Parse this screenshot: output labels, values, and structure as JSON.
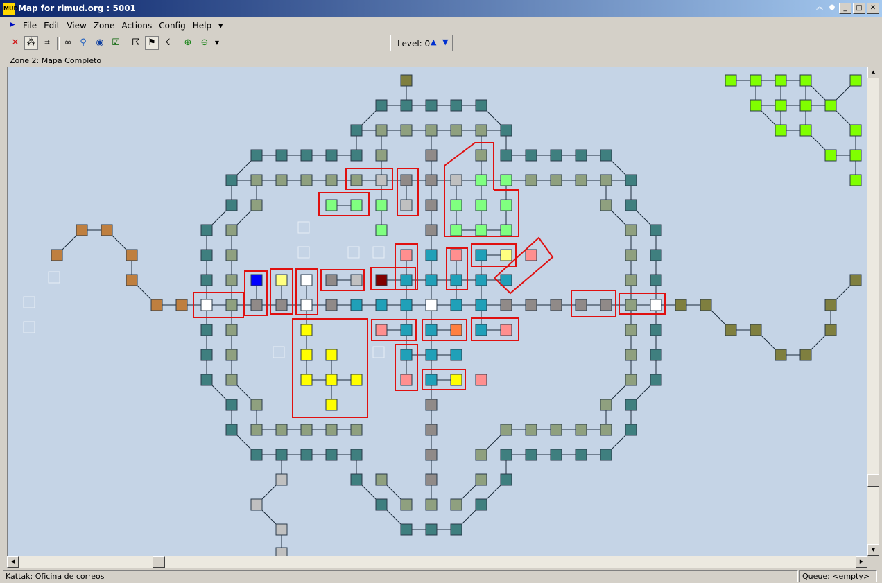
{
  "window": {
    "title": "Map for rlmud.org : 5001",
    "app_icon_text": "MUD"
  },
  "menu": {
    "items": [
      "File",
      "Edit",
      "View",
      "Zone",
      "Actions",
      "Config",
      "Help"
    ]
  },
  "level": {
    "label": "Level: 0"
  },
  "toolbar": {
    "icons": [
      "delete-icon",
      "group-icon",
      "links-icon",
      "binoculars-icon",
      "find-icon",
      "globe-icon",
      "checkbox-icon",
      "walk-icon",
      "speedwalk-icon",
      "run-icon",
      "zoom-in-icon",
      "zoom-out-icon"
    ],
    "active": [
      "group-icon",
      "speedwalk-icon"
    ]
  },
  "zone": {
    "label": "Zone 2: Mapa Completo"
  },
  "status": {
    "room": "Kattak: Oficina de correos",
    "queue": "Queue: <empty>"
  },
  "colors": {
    "map_bg": "#c5d4e6",
    "teal_dark": "#3f7f7f",
    "sage": "#8fa07f",
    "olive": "#7f7f3f",
    "brown": "#bf7f3f",
    "gray": "#908a88",
    "silver": "#c0c0c0",
    "light_green": "#80ff80",
    "lime": "#80ff00",
    "cyan": "#20a0b8",
    "pink": "#ff8f8f",
    "yellow": "#ffff00",
    "blue": "#0000ff",
    "maroon": "#800000",
    "white": "#ffffff",
    "orange": "#ff8040",
    "pale_yellow": "#ffff80",
    "highlight": "#e01010"
  }
}
